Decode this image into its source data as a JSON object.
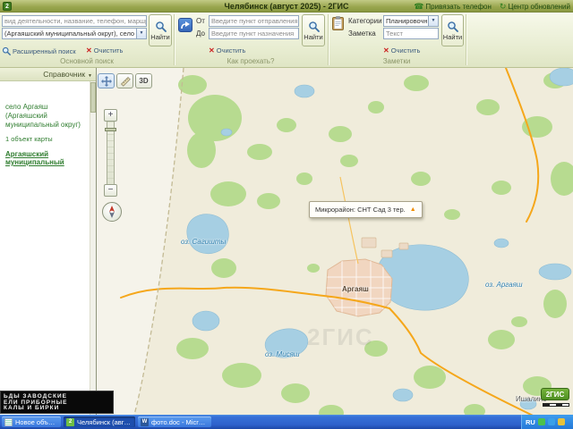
{
  "titlebar": {
    "title": "Челябинск (август 2025) - 2ГИС",
    "phone_link": "Привязать телефон",
    "updates_link": "Центр обновлений"
  },
  "ribbon": {
    "search": {
      "query_hint": "вид деятельности, название, телефон, маршрут",
      "where_value": "(Аргаяшский муниципальный округ), село Аргаяш",
      "advanced": "Расширенный поиск",
      "clear": "Очистить",
      "find": "Найти",
      "label": "Основной поиск"
    },
    "route": {
      "from_label": "От",
      "from_hint": "Введите пункт отправления",
      "to_label": "До",
      "to_hint": "Введите пункт назначения",
      "find": "Найти",
      "clear": "Очистить",
      "label": "Как проехать?"
    },
    "notes": {
      "category_label": "Категории",
      "category_value": "Планировочные",
      "note_label": "Заметка",
      "note_hint": "Текст",
      "find": "Найти",
      "clear": "Очистить",
      "label": "Заметки"
    }
  },
  "sidebar": {
    "header": "Справочник",
    "result_title": "село Аргаяш (Аргаяшский муниципальный округ)",
    "result_count": "1 объект карты",
    "result_link": "Аргаяшский муниципальный",
    "ad": [
      "ЬДЫ ЗАВОДСКИЕ",
      "ЕЛИ ПРИБОРНЫЕ",
      "КАЛЫ И БИРКИ"
    ]
  },
  "map": {
    "tooltip": "Микрорайон: СНТ Сад 3 тер.",
    "labels": {
      "lake_west": "оз. Сагишты",
      "lake_argayash": "оз. Аргаяш",
      "lake_south": "оз. Мисяш",
      "town": "Аргаяш",
      "village_se": "Ишалино"
    },
    "controls": {
      "zoom_in": "+",
      "zoom_out": "−",
      "view3d": "3D"
    },
    "logo": "2ГИС",
    "watermark": "2ГИС"
  },
  "taskbar": {
    "buttons": [
      {
        "label": "Новое объявление ..."
      },
      {
        "label": "Челябинск (август..."
      },
      {
        "label": "фото.doc - Microsoft..."
      }
    ],
    "lang": "RU"
  }
}
